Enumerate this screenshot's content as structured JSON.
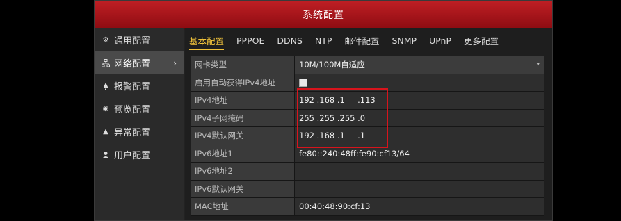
{
  "window": {
    "title": "系统配置"
  },
  "sidebar": {
    "items": [
      {
        "label": "通用配置",
        "icon": "gear-icon"
      },
      {
        "label": "网络配置",
        "icon": "network-icon",
        "active": true
      },
      {
        "label": "报警配置",
        "icon": "alarm-icon"
      },
      {
        "label": "预览配置",
        "icon": "preview-icon"
      },
      {
        "label": "异常配置",
        "icon": "warning-icon"
      },
      {
        "label": "用户配置",
        "icon": "user-icon"
      }
    ]
  },
  "tabs": [
    {
      "label": "基本配置",
      "active": true
    },
    {
      "label": "PPPOE"
    },
    {
      "label": "DDNS"
    },
    {
      "label": "NTP"
    },
    {
      "label": "邮件配置"
    },
    {
      "label": "SNMP"
    },
    {
      "label": "UPnP"
    },
    {
      "label": "更多配置"
    }
  ],
  "form": {
    "nic_type": {
      "label": "网卡类型",
      "value": "10M/100M自适应"
    },
    "dhcp": {
      "label": "启用自动获得IPv4地址",
      "checked": false
    },
    "ipv4_address": {
      "label": "IPv4地址",
      "value": "192 .168 .1     .113"
    },
    "ipv4_mask": {
      "label": "IPv4子网掩码",
      "value": "255 .255 .255 .0"
    },
    "ipv4_gateway": {
      "label": "IPv4默认网关",
      "value": "192 .168 .1     .1"
    },
    "ipv6_address1": {
      "label": "IPv6地址1",
      "value": "fe80::240:48ff:fe90:cf13/64"
    },
    "ipv6_address2": {
      "label": "IPv6地址2",
      "value": ""
    },
    "ipv6_gateway": {
      "label": "IPv6默认网关",
      "value": ""
    },
    "mac": {
      "label": "MAC地址",
      "value": "00:40:48:90:cf:13"
    }
  },
  "colors": {
    "title_bar": "#b5161c",
    "active_tab": "#f0c23b",
    "highlight": "#d7141c"
  }
}
